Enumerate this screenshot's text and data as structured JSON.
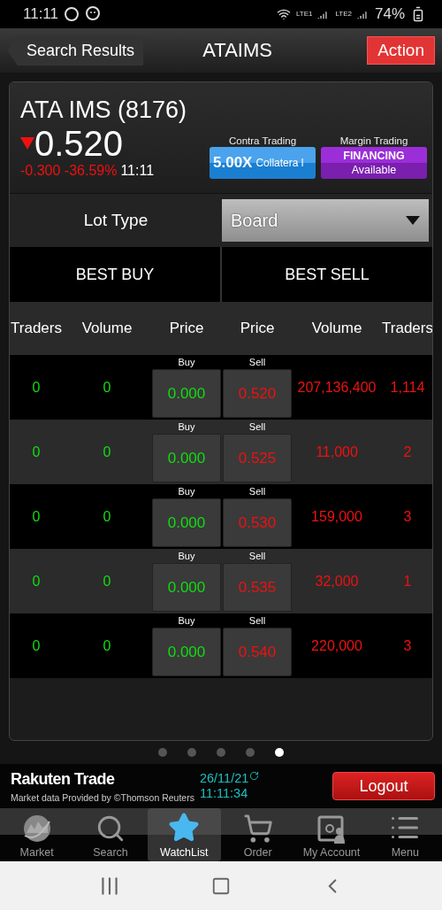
{
  "status_bar": {
    "time": "11:11",
    "networks": [
      "LTE1",
      "LTE2"
    ],
    "battery": "74%"
  },
  "nav": {
    "back": "Search Results",
    "title": "ATAIMS",
    "action": "Action"
  },
  "stock": {
    "name": "ATA IMS (8176)",
    "price": "0.520",
    "down": true,
    "change": "-0.300 -36.59%",
    "time": "11:11",
    "contra": {
      "label": "Contra Trading",
      "value": "5.00X",
      "note": "Collatera l"
    },
    "margin": {
      "label": "Margin Trading",
      "line1": "FINANCING",
      "line2": "Available"
    }
  },
  "lot_type": {
    "label": "Lot Type",
    "value": "Board"
  },
  "sides": [
    "BEST BUY",
    "BEST SELL"
  ],
  "columns": [
    "Traders",
    "Volume",
    "Price",
    "Price",
    "Volume",
    "Traders"
  ],
  "rows": [
    {
      "buy_traders": "0",
      "buy_volume": "0",
      "buy_label": "Buy",
      "buy_price": "0.000",
      "sell_label": "Sell",
      "sell_price": "0.520",
      "sell_volume": "207,136,400",
      "sell_traders": "1,114"
    },
    {
      "buy_traders": "0",
      "buy_volume": "0",
      "buy_label": "Buy",
      "buy_price": "0.000",
      "sell_label": "Sell",
      "sell_price": "0.525",
      "sell_volume": "11,000",
      "sell_traders": "2"
    },
    {
      "buy_traders": "0",
      "buy_volume": "0",
      "buy_label": "Buy",
      "buy_price": "0.000",
      "sell_label": "Sell",
      "sell_price": "0.530",
      "sell_volume": "159,000",
      "sell_traders": "3"
    },
    {
      "buy_traders": "0",
      "buy_volume": "0",
      "buy_label": "Buy",
      "buy_price": "0.000",
      "sell_label": "Sell",
      "sell_price": "0.535",
      "sell_volume": "32,000",
      "sell_traders": "1"
    },
    {
      "buy_traders": "0",
      "buy_volume": "0",
      "buy_label": "Buy",
      "buy_price": "0.000",
      "sell_label": "Sell",
      "sell_price": "0.540",
      "sell_volume": "220,000",
      "sell_traders": "3"
    }
  ],
  "pages": [
    {
      "selected": false
    },
    {
      "selected": false
    },
    {
      "selected": false
    },
    {
      "selected": false
    },
    {
      "selected": true
    }
  ],
  "footer": {
    "brand": "Rakuten Trade",
    "credit": "Market data Provided by ©Thomson Reuters",
    "date": "26/11/21",
    "time": "11:11:34",
    "logout": "Logout"
  },
  "tabs": [
    {
      "kind": "market",
      "label": "Market",
      "selected": false
    },
    {
      "kind": "search",
      "label": "Search",
      "selected": false
    },
    {
      "kind": "watchlist",
      "label": "WatchList",
      "selected": true
    },
    {
      "kind": "order",
      "label": "Order",
      "selected": false
    },
    {
      "kind": "account",
      "label": "My Account",
      "selected": false
    },
    {
      "kind": "menu",
      "label": "Menu",
      "selected": false
    }
  ]
}
